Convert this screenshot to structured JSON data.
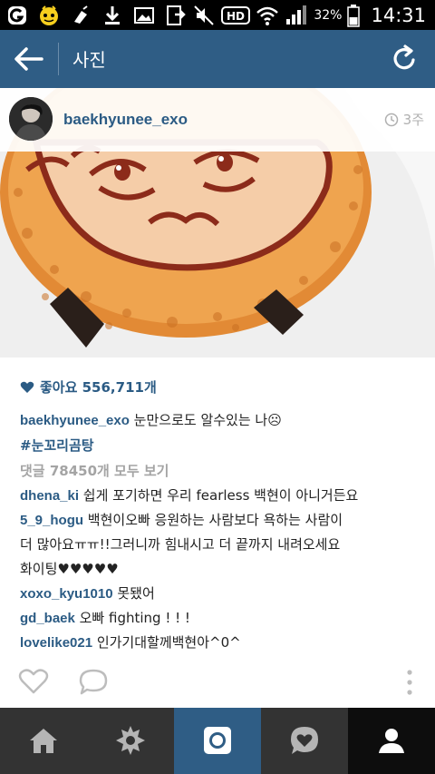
{
  "status_bar": {
    "battery": "32%",
    "time": "14:31",
    "network_badge": "HD"
  },
  "action_bar": {
    "title": "사진"
  },
  "post": {
    "username": "baekhyunee_exo",
    "time_ago": "3주",
    "likes_label": "좋아요 556,711개",
    "caption_user": "baekhyunee_exo",
    "caption_text": " 눈만으로도 알수있는 나☹",
    "hashtag": "#눈꼬리곰탕",
    "view_all_comments": "댓글 78450개 모두 보기"
  },
  "comments": [
    {
      "user": "dhena_ki",
      "text": " 쉽게 포기하면 우리 fearless 백현이 아니거든요"
    },
    {
      "user": "5_9_hogu",
      "text": " 백현이오빠 응원하는 사람보다 욕하는 사람이",
      "text2": "더 많아요ㅠㅠ!!그러니까 힘내시고 더 끝까지 내려오세요",
      "text3": "화이팅♥♥♥♥♥"
    },
    {
      "user": "xoxo_kyu1010",
      "text": " 못됐어"
    },
    {
      "user": "gd_baek",
      "text": " 오빠 fighting ! ! !"
    },
    {
      "user": "lovelike021",
      "text": " 인가기대할께백현아^0^"
    }
  ],
  "icons": {
    "status_left": [
      "g-logo-icon",
      "kakao-icon",
      "cleaner-icon",
      "download-icon",
      "image-icon",
      "file-transfer-icon"
    ],
    "status_right": [
      "mute-icon",
      "hd-icon",
      "wifi-icon",
      "signal-icon",
      "battery-icon"
    ],
    "nav": [
      "home-icon",
      "explore-icon",
      "camera-icon",
      "activity-icon",
      "profile-icon"
    ]
  },
  "colors": {
    "brand": "#2f5d85",
    "username": "#2b5b84",
    "nav_bg": "#333333"
  }
}
